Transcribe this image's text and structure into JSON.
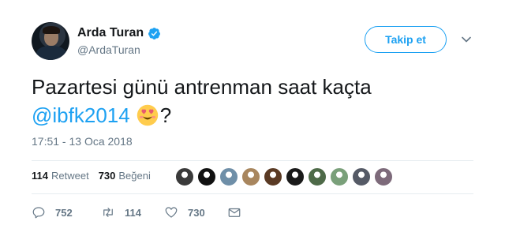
{
  "author": {
    "name": "Arda Turan",
    "handle": "@ArdaTuran",
    "verified": true
  },
  "follow_button": {
    "label": "Takip et"
  },
  "tweet": {
    "text_line1": "Pazartesi günü antrenman saat kaçta",
    "mention": "@ibfk2014",
    "trailing": "?",
    "emoji": "smiling-face-with-heart-eyes-emoji",
    "timestamp": "17:51 - 13 Oca 2018"
  },
  "stats": {
    "retweet_count": "114",
    "retweet_label": "Retweet",
    "like_count": "730",
    "like_label": "Beğeni"
  },
  "likers": [
    {
      "name": "liker-avatar-1",
      "color": "#3a3a3a"
    },
    {
      "name": "liker-avatar-2",
      "color": "#111111"
    },
    {
      "name": "liker-avatar-3",
      "color": "#6f8fa8"
    },
    {
      "name": "liker-avatar-4",
      "color": "#a8865e"
    },
    {
      "name": "liker-avatar-5",
      "color": "#5a3a24"
    },
    {
      "name": "liker-avatar-6",
      "color": "#1a1a1a"
    },
    {
      "name": "liker-avatar-7",
      "color": "#4e6a48"
    },
    {
      "name": "liker-avatar-8",
      "color": "#7aa07a"
    },
    {
      "name": "liker-avatar-9",
      "color": "#555a66"
    },
    {
      "name": "liker-avatar-10",
      "color": "#7d6a7a"
    }
  ],
  "actions": {
    "reply_count": "752",
    "retweet_count": "114",
    "like_count": "730"
  },
  "colors": {
    "accent": "#1da1f2",
    "text_primary": "#14171a",
    "text_secondary": "#657786",
    "border": "#e6ecf0"
  }
}
